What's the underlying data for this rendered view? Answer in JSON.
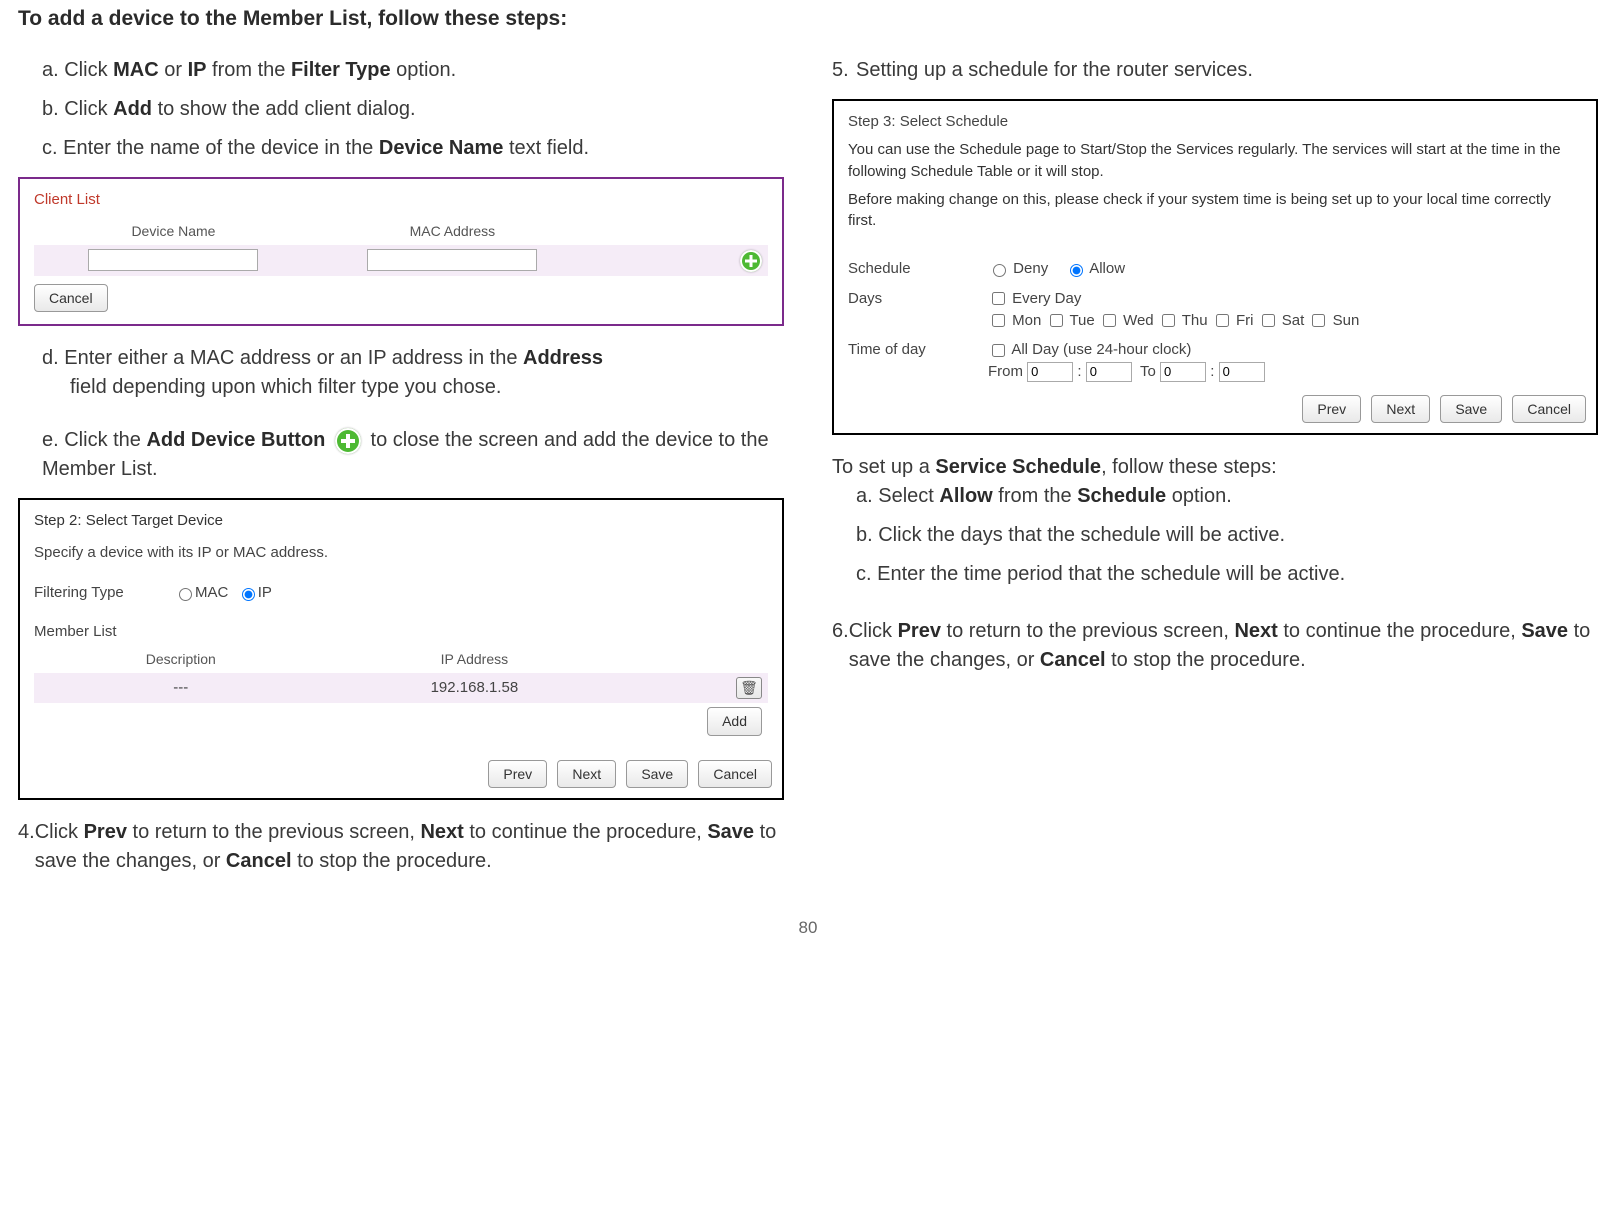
{
  "title": "To add a device to the Member List, follow these steps:",
  "left": {
    "a": {
      "pre": "a. Click ",
      "b1": "MAC",
      "mid1": " or ",
      "b2": "IP",
      "mid2": " from the ",
      "b3": "Filter Type",
      "post": " option."
    },
    "b": {
      "pre": "b. Click ",
      "b1": "Add",
      "post": " to show the add client dialog."
    },
    "c": {
      "pre": "c. Enter the name of the device in the ",
      "b1": "Device Name",
      "post": " text field."
    },
    "panel1": {
      "title": "Client List",
      "col1": "Device Name",
      "col2": "MAC Address",
      "cancel": "Cancel"
    },
    "d": {
      "pre": "d. Enter either a MAC address or an IP address in the ",
      "b1": "Address",
      "post": " field depending upon which filter type you chose."
    },
    "e": {
      "pre": "e. Click the ",
      "b1": "Add Device Button",
      "post1": " to close the screen and add the device to the Member List."
    },
    "panel2": {
      "step": "Step 2: Select Target Device",
      "desc": "Specify a device with its IP or MAC address.",
      "filtLabel": "Filtering Type",
      "mac": "MAC",
      "ip": "IP",
      "memberList": "Member List",
      "col1": "Description",
      "col2": "IP Address",
      "row1c1": "---",
      "row1c2": "192.168.1.58",
      "add": "Add",
      "prev": "Prev",
      "next": "Next",
      "save": "Save",
      "cancel": "Cancel"
    },
    "s4": {
      "num": "4.",
      "pre": "Click ",
      "b1": "Prev",
      "m1": " to return to the previous screen, ",
      "b2": "Next",
      "m2": " to continue the procedure, ",
      "b3": "Save",
      "m3": " to save the changes, or ",
      "b4": "Cancel",
      "m4": " to stop the procedure."
    }
  },
  "right": {
    "s5": {
      "num": "5.",
      "text": "Setting up a schedule for the router services."
    },
    "panel3": {
      "step": "Step 3: Select Schedule",
      "desc1": "You can use the Schedule page to Start/Stop the Services regularly. The services will start at the time in the following Schedule Table or it will stop.",
      "desc2": "Before making change on this, please check if your system time is being set up to your local time correctly first.",
      "schedule": "Schedule",
      "deny": "Deny",
      "allow": "Allow",
      "days": "Days",
      "every": "Every Day",
      "mon": "Mon",
      "tue": "Tue",
      "wed": "Wed",
      "thu": "Thu",
      "fri": "Fri",
      "sat": "Sat",
      "sun": "Sun",
      "tod": "Time of day",
      "allday": "All Day (use 24-hour clock)",
      "from": "From",
      "to": "To",
      "zero": "0",
      "prev": "Prev",
      "next": "Next",
      "save": "Save",
      "cancel": "Cancel"
    },
    "ss": {
      "pre": "To set up a ",
      "b1": "Service Schedule",
      "post": ", follow these steps:",
      "a": {
        "pre": "a. Select ",
        "b1": "Allow",
        "m1": " from the ",
        "b2": "Schedule",
        "post": " option."
      },
      "b": "b. Click the days that the schedule will be active.",
      "c": "c. Enter the time period that the schedule will be active."
    },
    "s6": {
      "num": "6.",
      "pre": "Click ",
      "b1": "Prev",
      "m1": " to return to the previous screen, ",
      "b2": "Next",
      "m2": " to continue the procedure, ",
      "b3": "Save",
      "m3": " to save the changes, or ",
      "b4": "Cancel",
      "m4": " to stop the procedure."
    }
  },
  "page": "80"
}
